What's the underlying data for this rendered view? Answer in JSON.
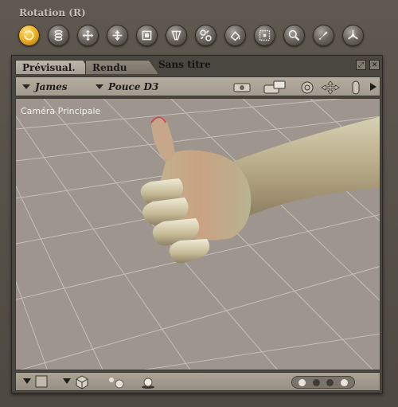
{
  "tool": {
    "title": "Rotation (R)"
  },
  "toolbar": {
    "buttons": [
      {
        "icon": "rotate-icon",
        "active": true
      },
      {
        "icon": "twist-icon"
      },
      {
        "icon": "translate-icon"
      },
      {
        "icon": "translate-in-out-icon"
      },
      {
        "icon": "scale-icon"
      },
      {
        "icon": "taper-icon"
      },
      {
        "icon": "chain-break-icon"
      },
      {
        "icon": "color-icon"
      },
      {
        "icon": "grouping-icon"
      },
      {
        "icon": "view-magnify-icon"
      },
      {
        "icon": "morph-brush-icon"
      },
      {
        "icon": "direct-manipulation-icon"
      }
    ]
  },
  "window": {
    "title": "Sans titre",
    "tabs": {
      "preview": "Prévisual.",
      "render": "Rendu"
    }
  },
  "options": {
    "figure": "James",
    "part": "Pouce D3"
  },
  "viewport": {
    "camera": "Caméra Principale"
  },
  "colors": {
    "accent": "#e9a81f",
    "background": "#9d958e",
    "grid": "#c9c2bb"
  }
}
